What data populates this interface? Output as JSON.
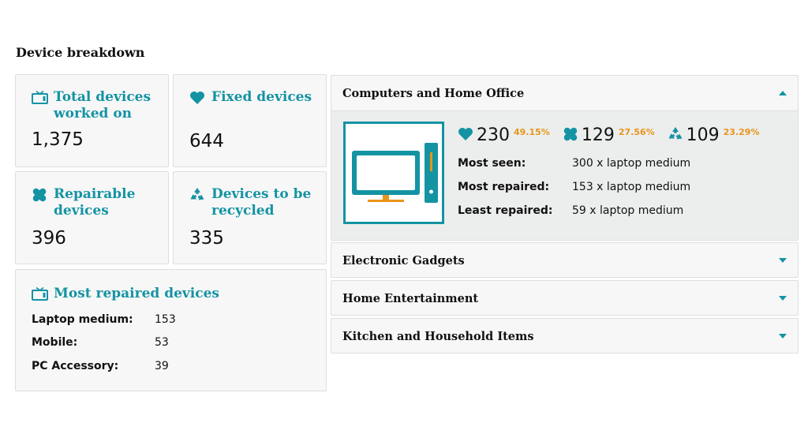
{
  "section_title": "Device breakdown",
  "colors": {
    "accent": "#1493a3",
    "percent": "#e8941a"
  },
  "cards": {
    "total": {
      "icon": "tv-icon",
      "label_line1": "Total devices",
      "label_line2": "worked on",
      "value": "1,375"
    },
    "fixed": {
      "icon": "heart-icon",
      "label": "Fixed devices",
      "value": "644"
    },
    "repairable": {
      "icon": "bandage-icon",
      "label_line1": "Repairable",
      "label_line2": "devices",
      "value": "396"
    },
    "recycled": {
      "icon": "recycle-icon",
      "label_line1": "Devices to be",
      "label_line2": "recycled",
      "value": "335"
    }
  },
  "most_repaired": {
    "icon": "tv-icon",
    "title": "Most repaired devices",
    "items": [
      {
        "label": "Laptop medium:",
        "value": "153"
      },
      {
        "label": "Mobile:",
        "value": "53"
      },
      {
        "label": "PC Accessory:",
        "value": "39"
      }
    ]
  },
  "categories": [
    {
      "name": "Computers and Home Office",
      "expanded": true,
      "stats": [
        {
          "icon": "heart-icon",
          "value": "230",
          "percent": "49.15%"
        },
        {
          "icon": "bandage-icon",
          "value": "129",
          "percent": "27.56%"
        },
        {
          "icon": "recycle-icon",
          "value": "109",
          "percent": "23.29%"
        }
      ],
      "details": [
        {
          "label": "Most seen:",
          "value": "300 x laptop medium"
        },
        {
          "label": "Most repaired:",
          "value": "153 x laptop medium"
        },
        {
          "label": "Least repaired:",
          "value": "59 x laptop medium"
        }
      ]
    },
    {
      "name": "Electronic Gadgets",
      "expanded": false
    },
    {
      "name": "Home Entertainment",
      "expanded": false
    },
    {
      "name": "Kitchen and Household Items",
      "expanded": false
    }
  ]
}
